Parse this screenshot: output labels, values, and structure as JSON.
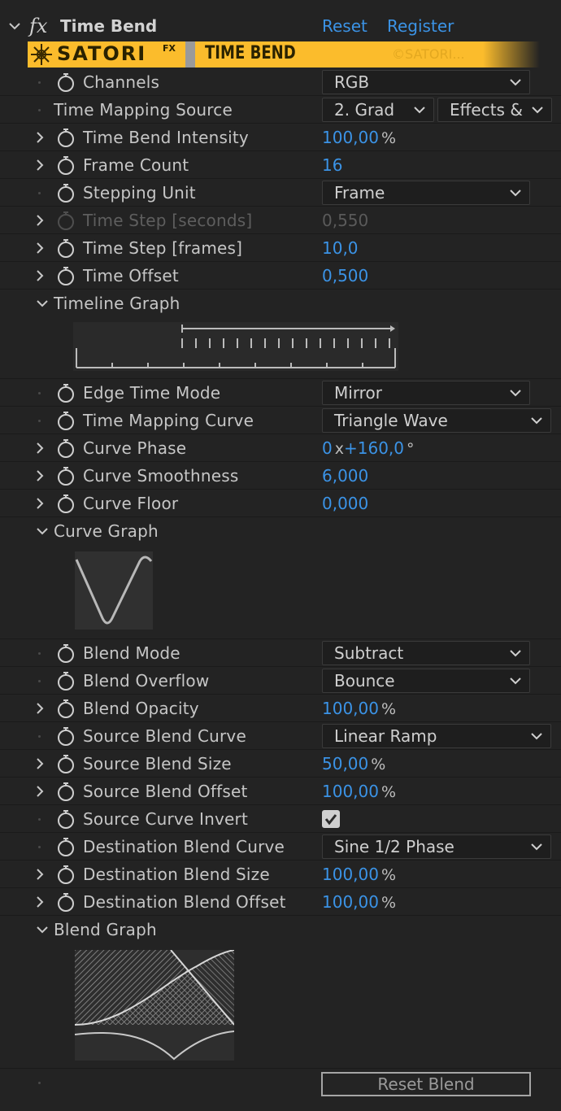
{
  "header": {
    "title": "Time Bend",
    "fx_glyph": "fx",
    "reset_label": "Reset",
    "register_label": "Register"
  },
  "banner": {
    "brand": "SATORI",
    "brand_sup": "FX",
    "product": "TIME BEND",
    "copyright": "©SATORI..."
  },
  "params": {
    "channels": {
      "label": "Channels",
      "value": "RGB"
    },
    "time_mapping_source": {
      "label": "Time Mapping Source",
      "value": "2. Grad",
      "value2": "Effects & M"
    },
    "time_bend_intensity": {
      "label": "Time Bend Intensity",
      "value": "100,00",
      "unit": "%"
    },
    "frame_count": {
      "label": "Frame Count",
      "value": "16"
    },
    "stepping_unit": {
      "label": "Stepping Unit",
      "value": "Frame"
    },
    "time_step_seconds": {
      "label": "Time Step [seconds]",
      "value": "0,550"
    },
    "time_step_frames": {
      "label": "Time Step [frames]",
      "value": "10,0"
    },
    "time_offset": {
      "label": "Time Offset",
      "value": "0,500"
    },
    "timeline_graph": {
      "label": "Timeline Graph"
    },
    "edge_time_mode": {
      "label": "Edge Time Mode",
      "value": "Mirror"
    },
    "time_mapping_curve": {
      "label": "Time Mapping Curve",
      "value": "Triangle Wave"
    },
    "curve_phase": {
      "label": "Curve Phase",
      "rev": "0",
      "rev_unit": "x",
      "value": "+160,0",
      "unit": "°"
    },
    "curve_smoothness": {
      "label": "Curve Smoothness",
      "value": "6,000"
    },
    "curve_floor": {
      "label": "Curve Floor",
      "value": "0,000"
    },
    "curve_graph": {
      "label": "Curve Graph"
    },
    "blend_mode": {
      "label": "Blend Mode",
      "value": "Subtract"
    },
    "blend_overflow": {
      "label": "Blend Overflow",
      "value": "Bounce"
    },
    "blend_opacity": {
      "label": "Blend Opacity",
      "value": "100,00",
      "unit": "%"
    },
    "source_blend_curve": {
      "label": "Source Blend Curve",
      "value": "Linear Ramp"
    },
    "source_blend_size": {
      "label": "Source Blend Size",
      "value": "50,00",
      "unit": "%"
    },
    "source_blend_offset": {
      "label": "Source Blend Offset",
      "value": "100,00",
      "unit": "%"
    },
    "source_curve_invert": {
      "label": "Source Curve Invert",
      "checked": true
    },
    "destination_blend_curve": {
      "label": "Destination Blend Curve",
      "value": "Sine 1/2 Phase"
    },
    "destination_blend_size": {
      "label": "Destination Blend Size",
      "value": "100,00",
      "unit": "%"
    },
    "destination_blend_offset": {
      "label": "Destination Blend Offset",
      "value": "100,00",
      "unit": "%"
    },
    "blend_graph": {
      "label": "Blend Graph"
    }
  },
  "reset_blend_label": "Reset Blend",
  "colors": {
    "background": "#232323",
    "value_blue": "#3b93e6",
    "banner_yellow": "#fbbc2c",
    "text": "#c6c6c6"
  }
}
